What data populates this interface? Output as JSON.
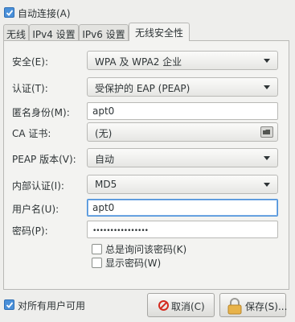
{
  "auto_connect": {
    "label": "自动连接(A)",
    "checked": true
  },
  "tabs": [
    {
      "label": "无线"
    },
    {
      "label": "IPv4 设置"
    },
    {
      "label": "IPv6 设置"
    },
    {
      "label": "无线安全性"
    }
  ],
  "form": {
    "security": {
      "label": "安全(E):",
      "value": "WPA 及 WPA2 企业"
    },
    "auth": {
      "label": "认证(T):",
      "value": "受保护的 EAP (PEAP)"
    },
    "anonymous_identity": {
      "label": "匿名身份(M):",
      "value": "apt0"
    },
    "ca_cert": {
      "label": "CA 证书:",
      "value": "(无)"
    },
    "peap_version": {
      "label": "PEAP 版本(V):",
      "value": "自动"
    },
    "inner_auth": {
      "label": "内部认证(I):",
      "value": "MD5"
    },
    "username": {
      "label": "用户名(U):",
      "value": "apt0"
    },
    "password": {
      "label": "密码(P):",
      "value": "••••••••••••••••"
    },
    "always_ask": {
      "label": "总是询问该密码(K)",
      "checked": false
    },
    "show_password": {
      "label": "显示密码(W)",
      "checked": false
    }
  },
  "all_users": {
    "label": "对所有用户可用",
    "checked": true
  },
  "buttons": {
    "cancel": "取消(C)",
    "save": "保存(S)..."
  },
  "colors": {
    "accent": "#4a90d9",
    "cancel_icon": "#d42a1e",
    "lock_icon": "#e8b34a"
  }
}
